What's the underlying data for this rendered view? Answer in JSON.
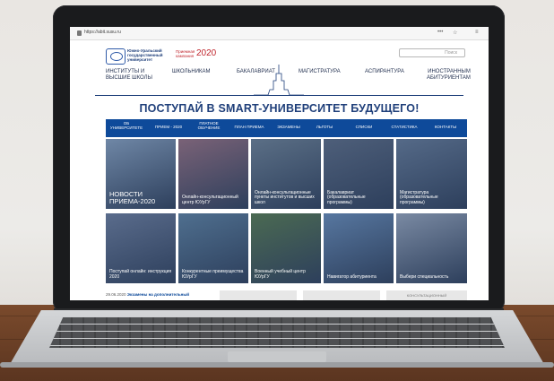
{
  "browser": {
    "url": "https://abit.susu.ru"
  },
  "site": {
    "university_lines": [
      "Южно-Уральский",
      "государственный",
      "университет"
    ],
    "campaign_lines": [
      "Приемная",
      "кампания"
    ],
    "year": "2020",
    "search_placeholder": "Поиск"
  },
  "top_nav": [
    {
      "line1": "ИНСТИТУТЫ И",
      "line2": "ВЫСШИЕ ШКОЛЫ"
    },
    {
      "line1": "ШКОЛЬНИКАМ",
      "line2": ""
    },
    {
      "line1": "БАКАЛАВРИАТ",
      "line2": ""
    },
    {
      "line1": "МАГИСТРАТУРА",
      "line2": ""
    },
    {
      "line1": "АСПИРАНТУРА",
      "line2": ""
    },
    {
      "line1": "ИНОСТРАННЫМ",
      "line2": "АБИТУРИЕНТАМ"
    }
  ],
  "slogan": "ПОСТУПАЙ В SMART-УНИВЕРСИТЕТ БУДУЩЕГО!",
  "blue_nav": [
    {
      "line1": "ОБ",
      "line2": "УНИВЕРСИТЕТЕ"
    },
    {
      "line1": "ПРИЕМ - 2020",
      "line2": ""
    },
    {
      "line1": "ПЛАТНОЕ",
      "line2": "ОБУЧЕНИЕ"
    },
    {
      "line1": "ПЛАН ПРИЕМА",
      "line2": ""
    },
    {
      "line1": "ЭКЗАМЕНЫ",
      "line2": ""
    },
    {
      "line1": "ЛЬГОТЫ",
      "line2": ""
    },
    {
      "line1": "СПИСКИ",
      "line2": ""
    },
    {
      "line1": "СТАТИСТИКА",
      "line2": ""
    },
    {
      "line1": "КОНТАКТЫ",
      "line2": ""
    }
  ],
  "tiles": [
    {
      "caption": "НОВОСТИ ПРИЕМА-2020",
      "color": "#6f87a6"
    },
    {
      "caption": "Онлайн-консультационный центр ЮУрГУ",
      "color": "#7a6277"
    },
    {
      "caption": "Онлайн-консультационные пункты институтов и высших школ",
      "color": "#5b6f86"
    },
    {
      "caption": "Бакалавриат (образовательные программы)",
      "color": "#4e5f7a"
    },
    {
      "caption": "Магистратура (образовательные программы)",
      "color": "#556a88"
    },
    {
      "caption": "Поступай онлайн: инструкция 2020",
      "color": "#5a6c8c"
    },
    {
      "caption": "Конкурентные преимущества ЮУрГУ",
      "color": "#4f6f8f"
    },
    {
      "caption": "Военный учебный центр ЮУрГУ",
      "color": "#4b6a52"
    },
    {
      "caption": "Навигатор абитуриента",
      "color": "#5777a0"
    },
    {
      "caption": "Выбери специальность",
      "color": "#7a8aa3"
    }
  ],
  "news": {
    "date": "29.06.2020",
    "text": "Экзамены на дополнительный"
  },
  "promo_box_text": "КОНСУЛЬТАЦИОННЫЙ"
}
